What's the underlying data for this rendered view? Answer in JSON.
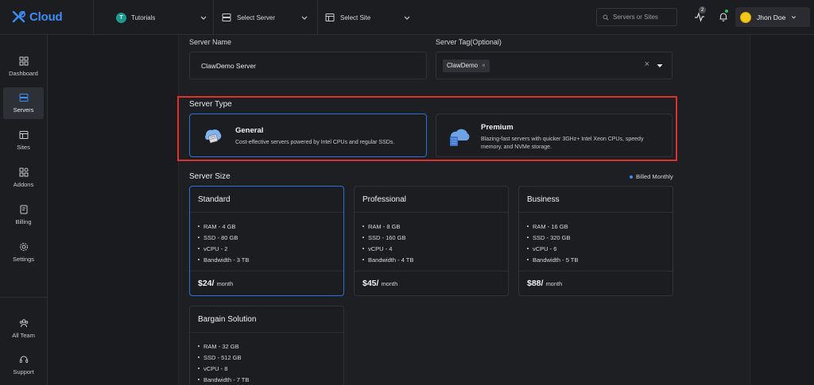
{
  "brand": {
    "name": "Cloud"
  },
  "header": {
    "project": {
      "badge": "T",
      "label": "Tutorials"
    },
    "server_select": {
      "label": "Select Server"
    },
    "site_select": {
      "label": "Select Site"
    },
    "search_placeholder": "Servers or Sites",
    "activity_count": "2",
    "user_name": "Jhon Doe"
  },
  "sidebar": {
    "items": [
      {
        "label": "Dashboard",
        "icon": "dashboard-icon"
      },
      {
        "label": "Servers",
        "icon": "servers-icon",
        "active": true
      },
      {
        "label": "Sites",
        "icon": "sites-icon"
      },
      {
        "label": "Addons",
        "icon": "addons-icon"
      },
      {
        "label": "Billing",
        "icon": "billing-icon"
      },
      {
        "label": "Settings",
        "icon": "settings-icon"
      }
    ],
    "bottom": [
      {
        "label": "All Team",
        "icon": "team-icon"
      },
      {
        "label": "Support",
        "icon": "support-icon"
      }
    ]
  },
  "form": {
    "server_name_label": "Server Name",
    "server_name_value": "ClawDemo Server",
    "server_tag_label": "Server Tag(Optional)",
    "server_tag_chip": "ClawDemo",
    "server_type_title": "Server Type",
    "server_types": [
      {
        "title": "General",
        "desc": "Cost-effective servers powered by Intel CPUs and regular SSDs.",
        "selected": true
      },
      {
        "title": "Premium",
        "desc": "Blazing-fast servers with quicker 3GHz+ Intel Xeon CPUs, speedy memory, and NVMe storage.",
        "selected": false
      }
    ],
    "server_size_title": "Server Size",
    "billed": "Billed Monthly",
    "sizes": [
      {
        "name": "Standard",
        "specs": [
          "RAM - 4 GB",
          "SSD - 80 GB",
          "vCPU - 2",
          "Bandwidth - 3 TB"
        ],
        "price": "$24/",
        "per": "month",
        "selected": true
      },
      {
        "name": "Professional",
        "specs": [
          "RAM - 8 GB",
          "SSD - 160 GB",
          "vCPU - 4",
          "Bandwidth - 4 TB"
        ],
        "price": "$45/",
        "per": "month",
        "selected": false
      },
      {
        "name": "Business",
        "specs": [
          "RAM - 16 GB",
          "SSD - 320 GB",
          "vCPU - 6",
          "Bandwidth - 5 TB"
        ],
        "price": "$88/",
        "per": "month",
        "selected": false
      },
      {
        "name": "Bargain Solution",
        "specs": [
          "RAM - 32 GB",
          "SSD - 512 GB",
          "vCPU - 8",
          "Bandwidth - 7 TB"
        ],
        "price": "",
        "per": "",
        "selected": false
      }
    ]
  },
  "colors": {
    "accent": "#3d8cf5",
    "highlight": "#e0302d",
    "selected_border": "#2e6fd6"
  }
}
